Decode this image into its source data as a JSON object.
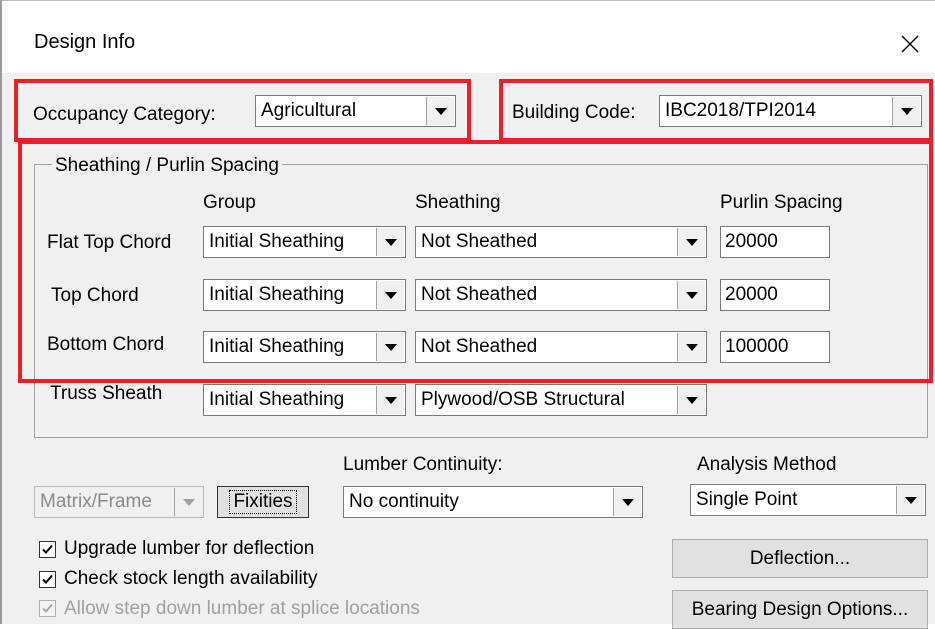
{
  "window": {
    "title": "Design Info",
    "close_glyph": "✕"
  },
  "occupancy": {
    "label": "Occupancy Category:",
    "value": "Agricultural"
  },
  "building_code": {
    "label": "Building Code:",
    "value": "IBC2018/TPI2014"
  },
  "sheathing": {
    "group_title": "Sheathing / Purlin Spacing",
    "headers": {
      "group": "Group",
      "sheathing": "Sheathing",
      "purlin": "Purlin Spacing"
    },
    "rows": [
      {
        "label": "Flat Top Chord",
        "group": "Initial Sheathing",
        "sheathing": "Not Sheathed",
        "purlin": "20000"
      },
      {
        "label": "Top Chord",
        "group": "Initial Sheathing",
        "sheathing": "Not Sheathed",
        "purlin": "20000"
      },
      {
        "label": "Bottom Chord",
        "group": "Initial Sheathing",
        "sheathing": "Not Sheathed",
        "purlin": "100000"
      },
      {
        "label": "Truss Sheath",
        "group": "Initial Sheathing",
        "sheathing": "Plywood/OSB Structural"
      }
    ]
  },
  "analysis": {
    "matrix_value": "Matrix/Frame",
    "fixities_label": "Fixities",
    "lumber_continuity_label": "Lumber Continuity:",
    "lumber_continuity_value": "No continuity",
    "analysis_method_label": "Analysis Method",
    "analysis_method_value": "Single Point"
  },
  "options": {
    "upgrade_lumber": {
      "label": "Upgrade lumber for deflection",
      "checked": true
    },
    "check_stock": {
      "label": "Check stock length availability",
      "checked": true
    },
    "step_down": {
      "label": "Allow step down lumber at splice locations",
      "checked": true,
      "disabled": true
    }
  },
  "buttons": {
    "deflection": "Deflection...",
    "bearing": "Bearing Design Options..."
  },
  "colors": {
    "highlight": "#e8202a",
    "client_bg": "#f0f0f0"
  }
}
